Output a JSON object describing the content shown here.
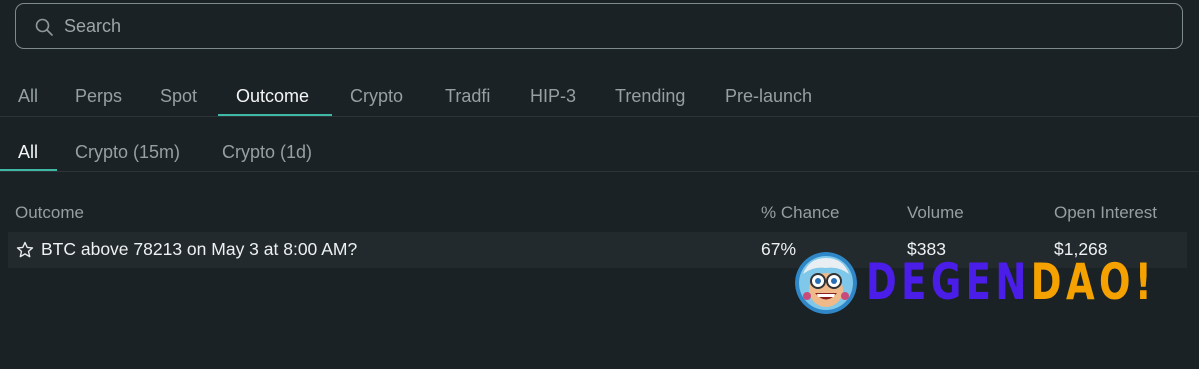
{
  "search": {
    "placeholder": "Search",
    "value": ""
  },
  "category_tabs": [
    {
      "label": "All"
    },
    {
      "label": "Perps"
    },
    {
      "label": "Spot"
    },
    {
      "label": "Outcome",
      "active": true
    },
    {
      "label": "Crypto"
    },
    {
      "label": "Tradfi"
    },
    {
      "label": "HIP-3"
    },
    {
      "label": "Trending"
    },
    {
      "label": "Pre-launch"
    }
  ],
  "sub_tabs": [
    {
      "label": "All",
      "active": true
    },
    {
      "label": "Crypto (15m)"
    },
    {
      "label": "Crypto (1d)"
    }
  ],
  "table": {
    "columns": [
      "Outcome",
      "% Chance",
      "Volume",
      "Open Interest"
    ],
    "rows": [
      {
        "outcome": "BTC above 78213 on May 3 at 8:00 AM?",
        "chance": "67%",
        "volume": "$383",
        "open_interest": "$1,268"
      }
    ]
  },
  "watermark": {
    "text_part1": "DEGEN",
    "text_part2": "DAO!"
  },
  "colors": {
    "background": "#1b2226",
    "accent": "#3fb8a5",
    "row_highlight": "#222a2e",
    "watermark_purple": "#4a1ee8",
    "watermark_orange": "#f5a100"
  },
  "icons": {
    "search": "search-icon",
    "favorite": "star-outline-icon"
  }
}
